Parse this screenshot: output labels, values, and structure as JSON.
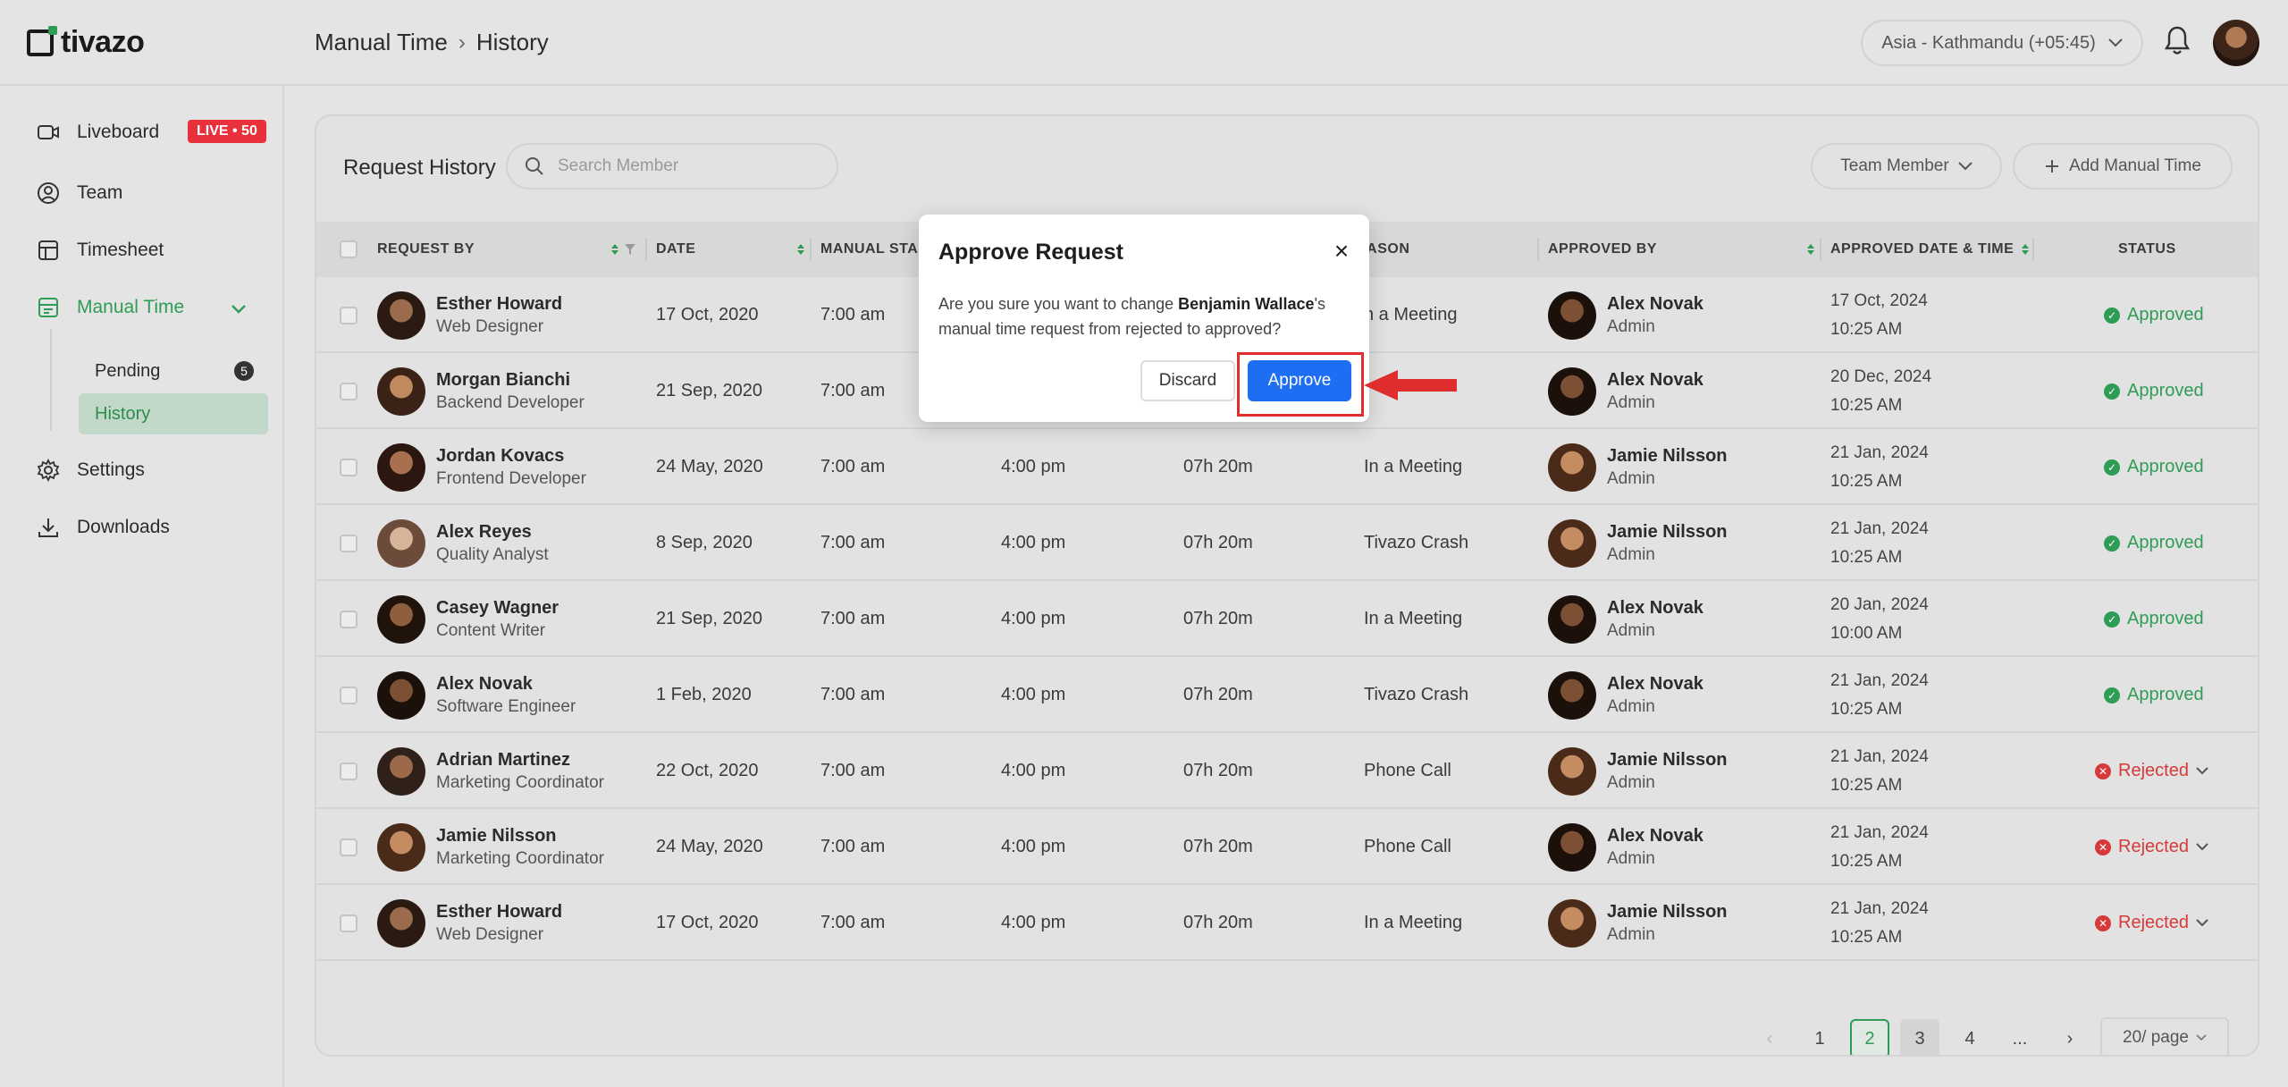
{
  "app": {
    "logo_text": "tivazo",
    "colors": {
      "accent": "#2e9c55",
      "danger": "#d63a3a",
      "primary": "#1d6ef2",
      "live": "#e8313a"
    }
  },
  "header": {
    "breadcrumb": [
      "Manual Time",
      "History"
    ],
    "timezone": "Asia - Kathmandu (+05:45)"
  },
  "sidebar": {
    "items": [
      {
        "label": "Liveboard",
        "icon": "liveboard-icon",
        "badge": "LIVE • 50"
      },
      {
        "label": "Team",
        "icon": "team-icon"
      },
      {
        "label": "Timesheet",
        "icon": "timesheet-icon"
      },
      {
        "label": "Manual Time",
        "icon": "manual-time-icon"
      },
      {
        "label": "Settings",
        "icon": "gear-icon"
      },
      {
        "label": "Downloads",
        "icon": "download-icon"
      }
    ],
    "sub_items": [
      {
        "label": "Pending",
        "count": "5"
      },
      {
        "label": "History"
      }
    ]
  },
  "main": {
    "title": "Request History",
    "search_placeholder": "Search Member",
    "team_member_label": "Team Member",
    "add_label": "Add Manual Time",
    "columns": [
      "REQUEST BY",
      "DATE",
      "MANUAL STAR",
      "EASON",
      "APPROVED BY",
      "APPROVED DATE & TIME",
      "STATUS"
    ],
    "rows": [
      {
        "name": "Esther Howard",
        "role": "Web Designer",
        "date": "17 Oct, 2020",
        "start": "7:00 am",
        "end": "",
        "duration": "",
        "reason": "n  a Meeting",
        "approver": "Alex Novak",
        "approver_role": "Admin",
        "approved_date": "17 Oct, 2024",
        "approved_time": "10:25 AM",
        "status": "Approved"
      },
      {
        "name": "Morgan Bianchi",
        "role": "Backend Developer",
        "date": "21 Sep, 2020",
        "start": "7:00 am",
        "end": "",
        "duration": "",
        "reason": "",
        "approver": "Alex Novak",
        "approver_role": "Admin",
        "approved_date": "20 Dec, 2024",
        "approved_time": "10:25 AM",
        "status": "Approved"
      },
      {
        "name": "Jordan Kovacs",
        "role": "Frontend Developer",
        "date": "24 May, 2020",
        "start": "7:00 am",
        "end": "4:00 pm",
        "duration": "07h 20m",
        "reason": "In  a Meeting",
        "approver": "Jamie Nilsson",
        "approver_role": "Admin",
        "approved_date": "21 Jan, 2024",
        "approved_time": "10:25 AM",
        "status": "Approved"
      },
      {
        "name": "Alex Reyes",
        "role": "Quality Analyst",
        "date": "8 Sep, 2020",
        "start": "7:00 am",
        "end": "4:00 pm",
        "duration": "07h 20m",
        "reason": "Tivazo Crash",
        "approver": "Jamie Nilsson",
        "approver_role": "Admin",
        "approved_date": "21 Jan, 2024",
        "approved_time": "10:25 AM",
        "status": "Approved"
      },
      {
        "name": "Casey Wagner",
        "role": "Content Writer",
        "date": "21 Sep, 2020",
        "start": "7:00 am",
        "end": "4:00 pm",
        "duration": "07h 20m",
        "reason": "In  a Meeting",
        "approver": "Alex Novak",
        "approver_role": "Admin",
        "approved_date": "20 Jan, 2024",
        "approved_time": "10:00 AM",
        "status": "Approved"
      },
      {
        "name": "Alex Novak",
        "role": "Software Engineer",
        "date": "1 Feb, 2020",
        "start": "7:00 am",
        "end": "4:00 pm",
        "duration": "07h 20m",
        "reason": "Tivazo Crash",
        "approver": "Alex Novak",
        "approver_role": "Admin",
        "approved_date": "21 Jan, 2024",
        "approved_time": "10:25 AM",
        "status": "Approved"
      },
      {
        "name": "Adrian Martinez",
        "role": "Marketing Coordinator",
        "date": "22 Oct, 2020",
        "start": "7:00 am",
        "end": "4:00 pm",
        "duration": "07h 20m",
        "reason": "Phone Call",
        "approver": "Jamie Nilsson",
        "approver_role": "Admin",
        "approved_date": "21 Jan, 2024",
        "approved_time": "10:25 AM",
        "status": "Rejected"
      },
      {
        "name": "Jamie Nilsson",
        "role": "Marketing Coordinator",
        "date": "24 May, 2020",
        "start": "7:00 am",
        "end": "4:00 pm",
        "duration": "07h 20m",
        "reason": "Phone Call",
        "approver": "Alex Novak",
        "approver_role": "Admin",
        "approved_date": "21 Jan, 2024",
        "approved_time": "10:25 AM",
        "status": "Rejected"
      },
      {
        "name": "Esther Howard",
        "role": "Web Designer",
        "date": "17 Oct, 2020",
        "start": "7:00 am",
        "end": "4:00 pm",
        "duration": "07h 20m",
        "reason": "In  a Meeting",
        "approver": "Jamie Nilsson",
        "approver_role": "Admin",
        "approved_date": "21 Jan, 2024",
        "approved_time": "10:25 AM",
        "status": "Rejected"
      }
    ]
  },
  "pagination": {
    "pages": [
      "1",
      "2",
      "3",
      "4",
      "..."
    ],
    "current": "2",
    "page_size": "20/ page"
  },
  "modal": {
    "title": "Approve Request",
    "body_prefix": "Are you sure you want to change ",
    "member": "Benjamin Wallace",
    "body_suffix": "'s manual time request from rejected to approved?",
    "discard_label": "Discard",
    "approve_label": "Approve"
  }
}
